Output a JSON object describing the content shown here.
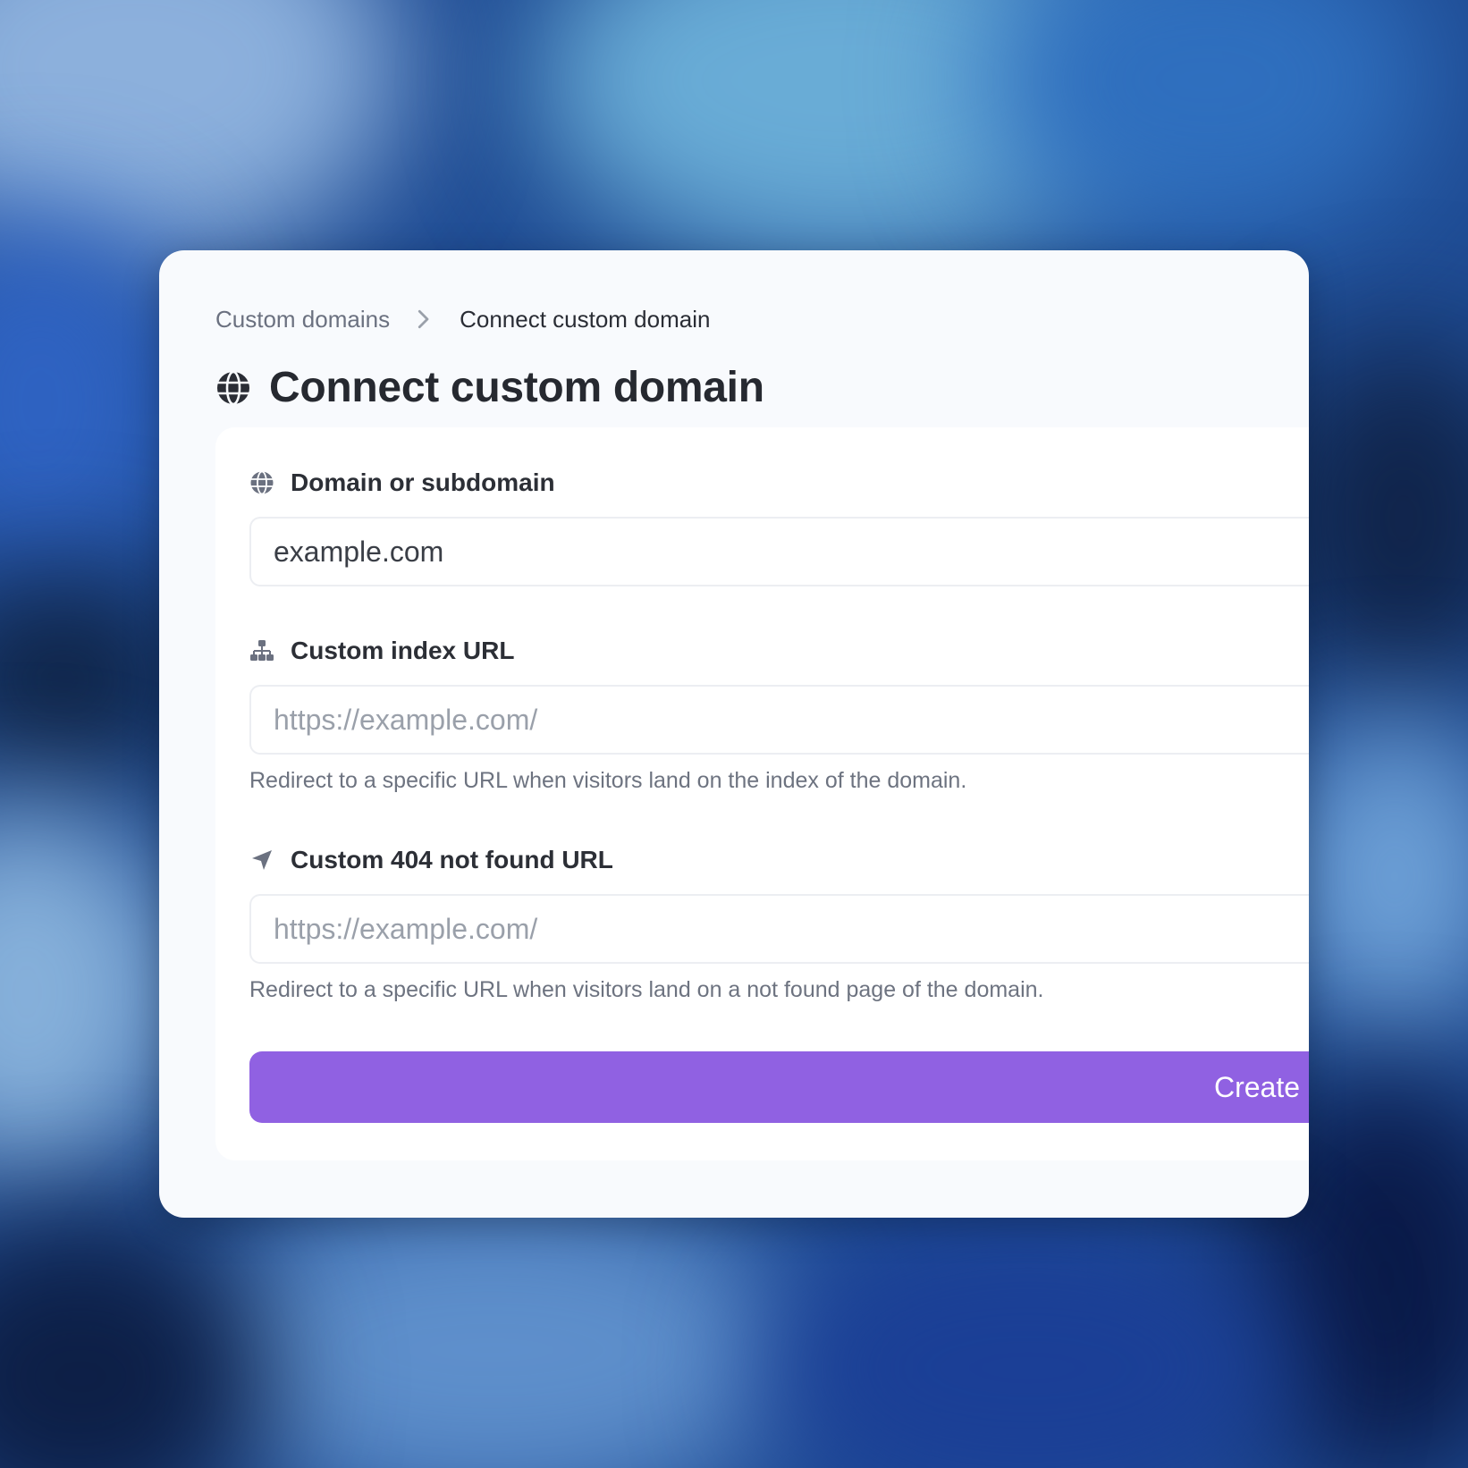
{
  "breadcrumb": {
    "parent": "Custom domains",
    "separator_icon": "chevron-right-icon",
    "current": "Connect custom domain"
  },
  "header": {
    "icon": "globe-icon",
    "title": "Connect custom domain"
  },
  "form": {
    "domain": {
      "icon": "globe-icon",
      "label": "Domain or subdomain",
      "value": "example.com",
      "placeholder": ""
    },
    "index_url": {
      "icon": "sitemap-icon",
      "label": "Custom index URL",
      "value": "",
      "placeholder": "https://example.com/",
      "help": "Redirect to a specific URL when visitors land on the index of the domain."
    },
    "not_found_url": {
      "icon": "location-arrow-icon",
      "label": "Custom 404 not found URL",
      "value": "",
      "placeholder": "https://example.com/",
      "help": "Redirect to a specific URL when visitors land on a not found page of the domain."
    },
    "submit_label": "Create"
  },
  "colors": {
    "accent": "#9061e2",
    "card_background": "#f8fafd",
    "panel_background": "#ffffff"
  }
}
